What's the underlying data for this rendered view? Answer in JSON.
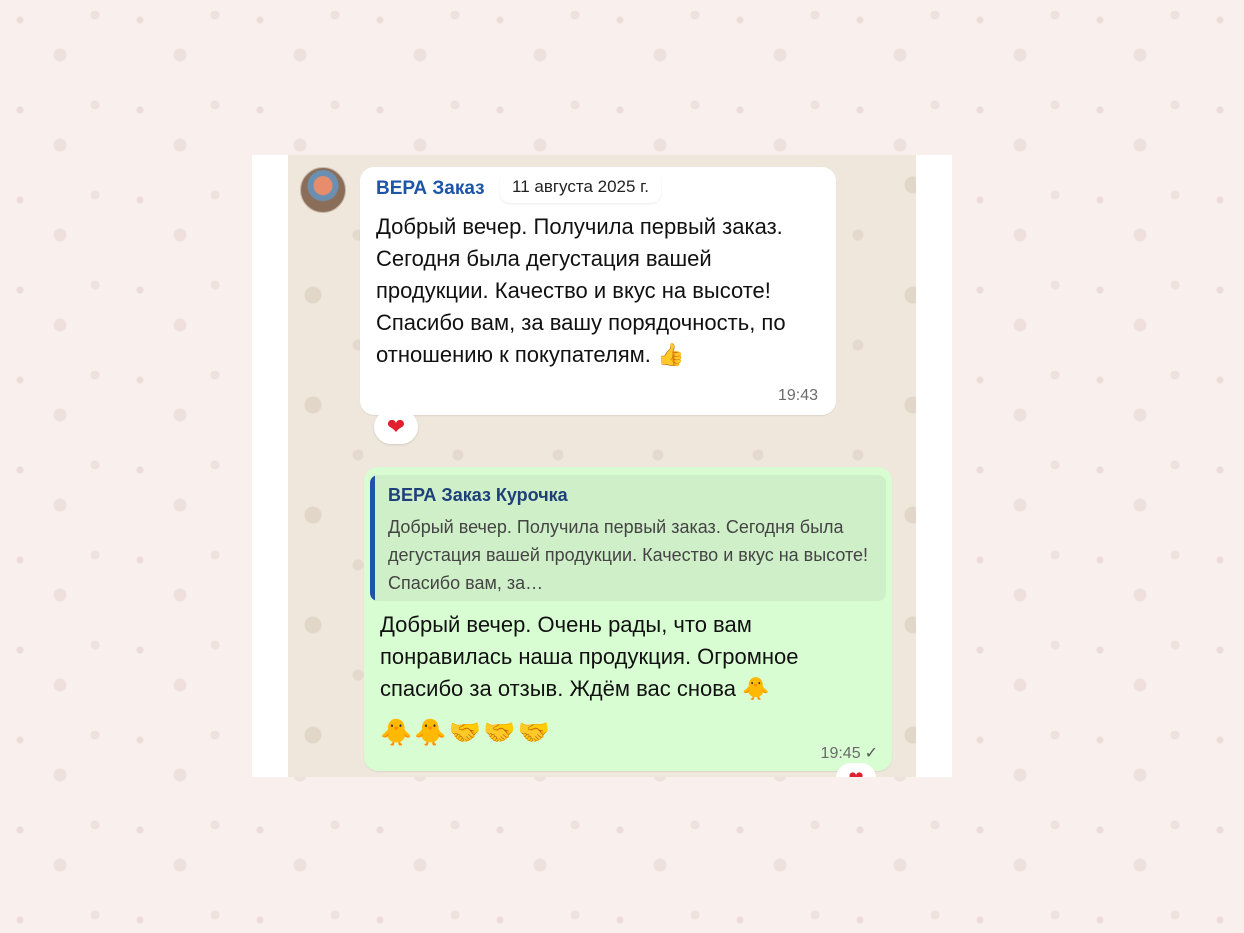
{
  "colors": {
    "outer_bg": "#f9efec",
    "chat_bg": "#efe7dc",
    "incoming_bubble": "#ffffff",
    "outgoing_bubble": "#d9fdd3",
    "sender_name": "#1d55a6",
    "heart": "#e0202e"
  },
  "date_divider": "11 августа 2025 г.",
  "incoming_message": {
    "sender": "ВЕРА Заказ",
    "text": "Добрый вечер. Получила первый заказ. Сегодня была дегустация вашей продукции. Качество и вкус на высоте! Спасибо вам, за вашу порядочность, по отношению к покупателям. 👍",
    "time": "19:43",
    "reaction": "❤"
  },
  "outgoing_message": {
    "quote_sender": "ВЕРА Заказ Курочка",
    "quote_text": "Добрый вечер. Получила первый заказ. Сегодня была дегустация вашей продукции. Качество и вкус на высоте! Спасибо вам, за…",
    "text": "Добрый вечер. Очень рады, что вам понравилась наша продукция. Огромное спасибо за отзыв. Ждём вас снова 🐥",
    "emojis": "🐥🐥🤝🤝🤝",
    "time": "19:45",
    "status_icon": "check-icon",
    "status_glyph": "✓",
    "reaction": "❤"
  }
}
